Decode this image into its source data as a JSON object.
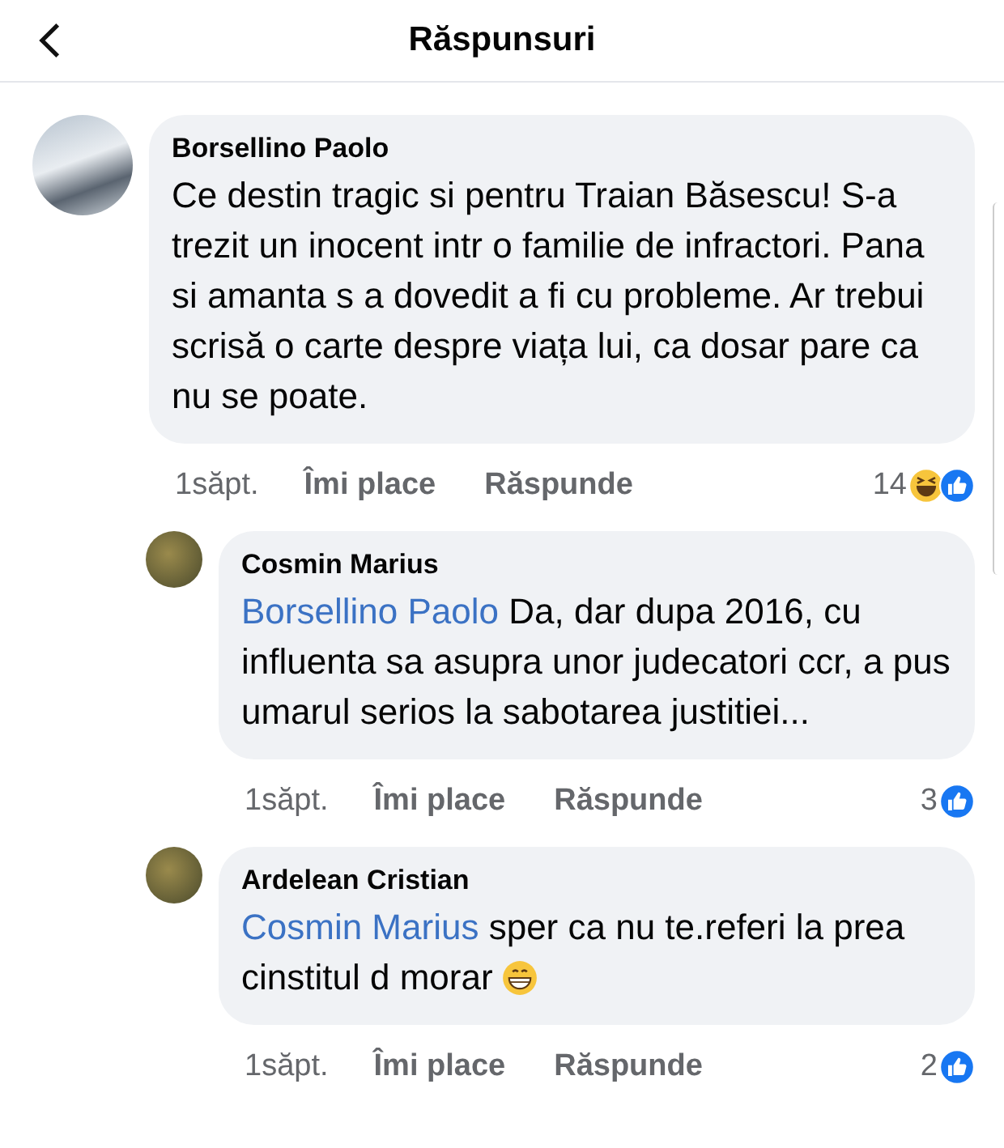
{
  "header": {
    "title": "Răspunsuri"
  },
  "comment": {
    "author": "Borsellino Paolo",
    "text": "Ce destin tragic si pentru Traian Băsescu! S-a trezit un inocent intr o familie de infractori. Pana si amanta s a dovedit a fi cu probleme. Ar trebui scrisă o carte despre viața lui, ca dosar pare ca nu se poate.",
    "time": "1săpt.",
    "like_label": "Îmi place",
    "reply_label": "Răspunde",
    "reaction_count": "14",
    "reactions": [
      {
        "kind": "haha"
      },
      {
        "kind": "like"
      }
    ],
    "replies": [
      {
        "author": "Cosmin Marius",
        "mention": "Borsellino Paolo",
        "text": "Da, dar dupa 2016, cu influenta sa asupra unor judecatori ccr, a pus umarul serios la sabotarea justitiei...",
        "time": "1săpt.",
        "like_label": "Îmi place",
        "reply_label": "Răspunde",
        "reaction_count": "3",
        "reactions": [
          {
            "kind": "like"
          }
        ]
      },
      {
        "author": "Ardelean Cristian",
        "mention": "Cosmin Marius",
        "text": "sper ca nu te.referi la prea cinstitul d morar",
        "end_emoji": {
          "kind": "grin"
        },
        "time": "1săpt.",
        "like_label": "Îmi place",
        "reply_label": "Răspunde",
        "reaction_count": "2",
        "reactions": [
          {
            "kind": "like"
          }
        ]
      }
    ]
  }
}
